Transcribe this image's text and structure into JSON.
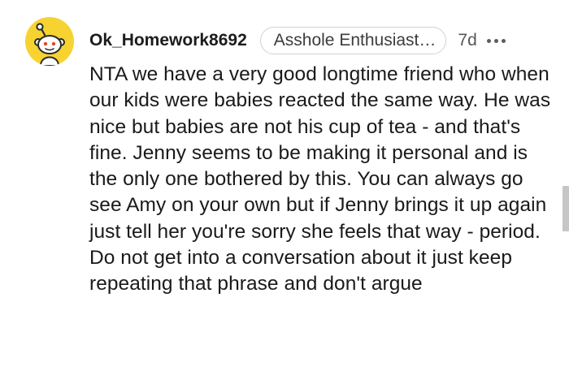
{
  "comment": {
    "username": "Ok_Homework8692",
    "flair": "Asshole Enthusiast…",
    "age": "7d",
    "more_icon": "ellipsis-icon",
    "avatar_icon": "reddit-snoo-avatar",
    "body": "NTA we have a very good longtime friend who when our kids were babies reacted the same way. He was nice but babies are not his cup of tea - and that's fine. Jenny seems to be making it personal and is the only one bothered by this. You can always go see Amy on your own but if Jenny brings it up again just tell her you're sorry she feels that way - period. Do not get into a conversation about it just keep repeating that phrase and don't argue"
  },
  "colors": {
    "avatar_background": "#f7d331",
    "text": "#1a1a1b",
    "meta": "#555657",
    "flair_border": "#cfd1d4"
  }
}
